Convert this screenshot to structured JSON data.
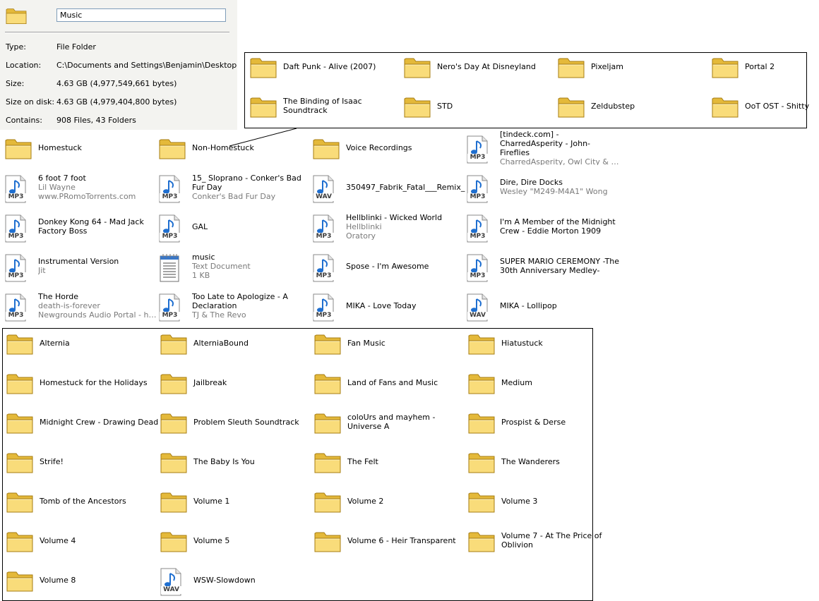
{
  "properties": {
    "name": "Music",
    "type_label": "Type:",
    "type_value": "File Folder",
    "location_label": "Location:",
    "location_value": "C:\\Documents and Settings\\Benjamin\\Desktop",
    "size_label": "Size:",
    "size_value": "4.63 GB (4,977,549,661 bytes)",
    "size_on_disk_label": "Size on disk:",
    "size_on_disk_value": "4.63 GB (4,979,404,800 bytes)",
    "contains_label": "Contains:",
    "contains_value": "908 Files, 43 Folders"
  },
  "subfolders": [
    {
      "icon": "folder-icon",
      "name": "Daft Punk - Alive (2007)"
    },
    {
      "icon": "folder-icon",
      "name": "Nero's Day At Disneyland"
    },
    {
      "icon": "folder-icon",
      "name": "Pixeljam"
    },
    {
      "icon": "folder-icon",
      "name": "Portal 2"
    },
    {
      "icon": "folder-icon",
      "name": "The Binding of Isaac Soundtrack"
    },
    {
      "icon": "folder-icon",
      "name": "STD"
    },
    {
      "icon": "folder-icon",
      "name": "Zeldubstep"
    },
    {
      "icon": "folder-icon",
      "name": "OoT OST - Shitty"
    }
  ],
  "items": [
    {
      "icon": "folder-icon",
      "name": "Homestuck"
    },
    {
      "icon": "folder-icon",
      "name": "Non-Homestuck"
    },
    {
      "icon": "folder-icon",
      "name": "Voice Recordings"
    },
    {
      "icon": "mp3-icon",
      "badge": "MP3",
      "name": "[tindeck.com] - CharredAsperity - John-Fireflies",
      "sub1": "CharredAsperity, Owl City & Ca"
    },
    {
      "icon": "mp3-icon",
      "badge": "MP3",
      "name": "6 foot 7 foot",
      "sub1": "Lil Wayne",
      "sub2": "www.PRomoTorrents.com"
    },
    {
      "icon": "mp3-icon",
      "badge": "MP3",
      "name": "15_ Sloprano - Conker's Bad Fur Day",
      "sub1": "Conker's Bad Fur Day"
    },
    {
      "icon": "wav-icon",
      "badge": "WAV",
      "name": "350497_Fabrik_Fatal___Remix_"
    },
    {
      "icon": "mp3-icon",
      "badge": "MP3",
      "name": "Dire, Dire Docks",
      "sub1": "Wesley \"M249-M4A1\" Wong"
    },
    {
      "icon": "mp3-icon",
      "badge": "MP3",
      "name": "Donkey Kong 64 - Mad Jack Factory Boss"
    },
    {
      "icon": "mp3-icon",
      "badge": "MP3",
      "name": "GAL"
    },
    {
      "icon": "mp3-icon",
      "badge": "MP3",
      "name": "Hellblinki - Wicked World",
      "sub1": "Hellblinki",
      "sub2": "Oratory"
    },
    {
      "icon": "mp3-icon",
      "badge": "MP3",
      "name": "I'm A Member of the Midnight Crew - Eddie Morton 1909"
    },
    {
      "icon": "mp3-icon",
      "badge": "MP3",
      "name": "Instrumental Version",
      "sub1": "Jit"
    },
    {
      "icon": "text-document-icon",
      "name": "music",
      "sub1": "Text Document",
      "sub2": "1 KB"
    },
    {
      "icon": "mp3-icon",
      "badge": "MP3",
      "name": "Spose - I'm Awesome"
    },
    {
      "icon": "mp3-icon",
      "badge": "MP3",
      "name": "SUPER MARIO CEREMONY -The 30th Anniversary Medley-"
    },
    {
      "icon": "mp3-icon",
      "badge": "MP3",
      "name": "The Horde",
      "sub1": "death-is-forever",
      "sub2": "Newgrounds Audio Portal - htt..."
    },
    {
      "icon": "mp3-icon",
      "badge": "MP3",
      "name": "Too Late to Apologize - A Declaration",
      "sub1": "TJ & The Revo"
    },
    {
      "icon": "mp3-icon",
      "badge": "MP3",
      "name": "MIKA - Love Today"
    },
    {
      "icon": "wav-icon",
      "badge": "WAV",
      "name": "MIKA - Lollipop"
    }
  ],
  "homestuck_items": [
    {
      "icon": "folder-icon",
      "name": "Alternia"
    },
    {
      "icon": "folder-icon",
      "name": "AlterniaBound"
    },
    {
      "icon": "folder-icon",
      "name": "Fan Music"
    },
    {
      "icon": "folder-icon",
      "name": "Hiatustuck"
    },
    {
      "icon": "folder-icon",
      "name": "Homestuck for the Holidays"
    },
    {
      "icon": "folder-icon",
      "name": "Jailbreak"
    },
    {
      "icon": "folder-icon",
      "name": "Land of Fans and Music"
    },
    {
      "icon": "folder-icon",
      "name": "Medium"
    },
    {
      "icon": "folder-icon",
      "name": "Midnight Crew - Drawing Dead"
    },
    {
      "icon": "folder-icon",
      "name": "Problem Sleuth Soundtrack"
    },
    {
      "icon": "folder-icon",
      "name": "coloUrs and mayhem - Universe A"
    },
    {
      "icon": "folder-icon",
      "name": "Prospist & Derse"
    },
    {
      "icon": "folder-icon",
      "name": "Strife!"
    },
    {
      "icon": "folder-icon",
      "name": "The Baby Is You"
    },
    {
      "icon": "folder-icon",
      "name": "The Felt"
    },
    {
      "icon": "folder-icon",
      "name": "The Wanderers"
    },
    {
      "icon": "folder-icon",
      "name": "Tomb of the Ancestors"
    },
    {
      "icon": "folder-icon",
      "name": "Volume 1"
    },
    {
      "icon": "folder-icon",
      "name": "Volume 2"
    },
    {
      "icon": "folder-icon",
      "name": "Volume 3"
    },
    {
      "icon": "folder-icon",
      "name": "Volume 4"
    },
    {
      "icon": "folder-icon",
      "name": "Volume 5"
    },
    {
      "icon": "folder-icon",
      "name": "Volume 6 - Heir Transparent"
    },
    {
      "icon": "folder-icon",
      "name": "Volume 7 - At The Price of Oblivion"
    },
    {
      "icon": "folder-icon",
      "name": "Volume 8"
    },
    {
      "icon": "wav-icon",
      "badge": "WAV",
      "name": "WSW-Slowdown"
    }
  ]
}
